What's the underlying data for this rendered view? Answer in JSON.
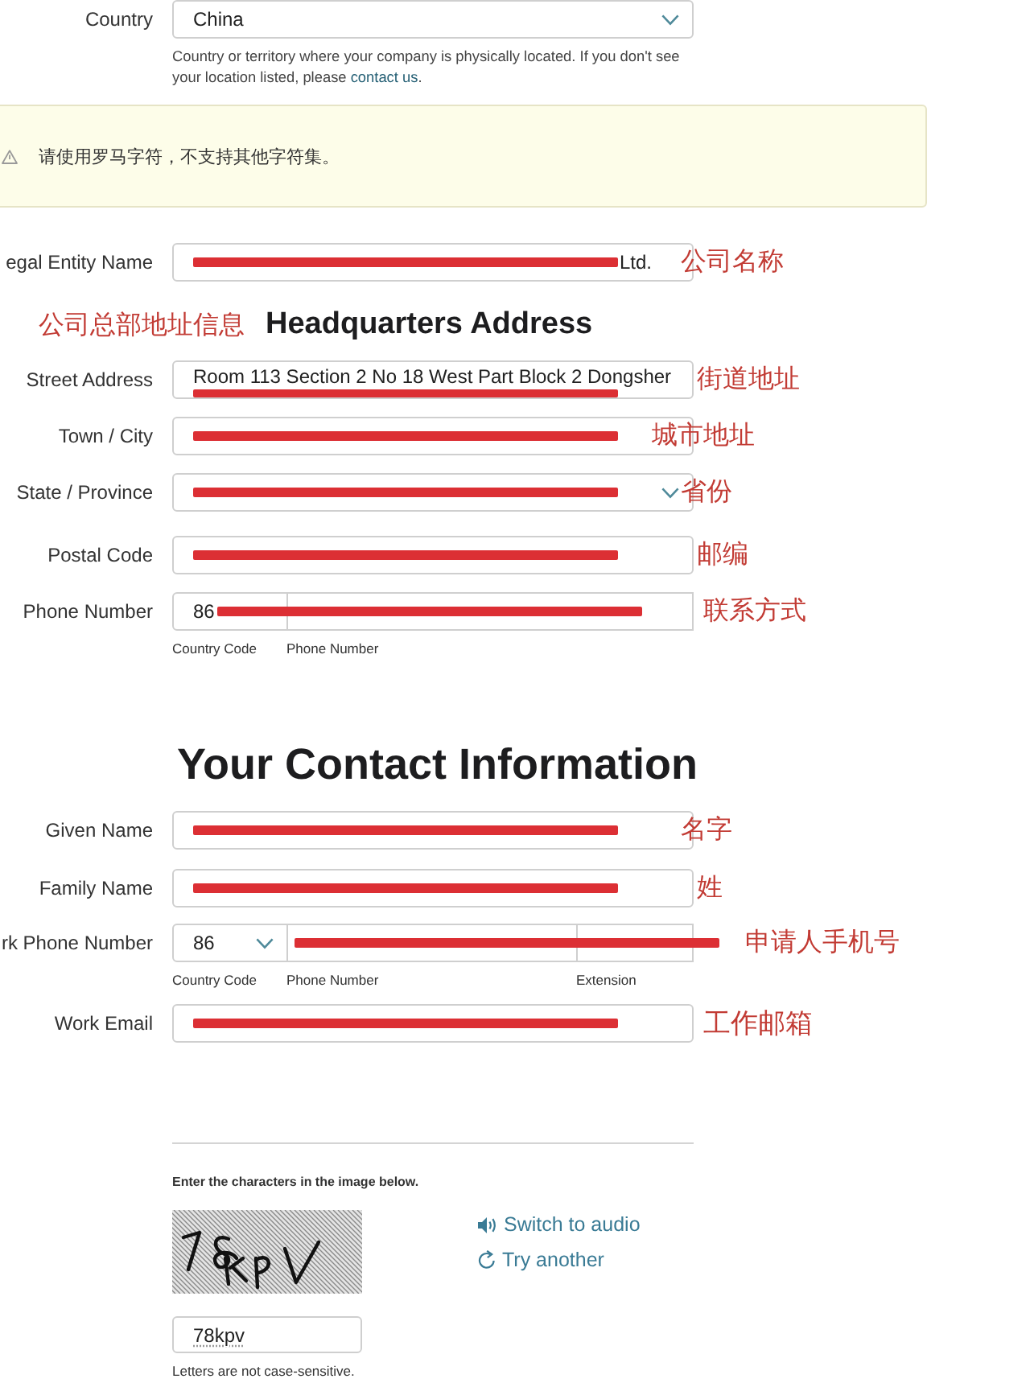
{
  "country": {
    "kind": "select",
    "label": "Country",
    "value": "China",
    "help": "Country or territory where your company is physically located. If you don't see your location listed, please ",
    "help_link": "contact us",
    "help_end": "."
  },
  "warning": {
    "text": "请使用罗马字符，不支持其他字符集。"
  },
  "entity": {
    "kind": "text",
    "label": "egal Entity Name",
    "value": "Ltd.",
    "redaction": {
      "kind": "hide"
    },
    "note": "公司名称"
  },
  "headquarters": {
    "note": "公司总部地址信息",
    "title": "Headquarters Address",
    "fields": [
      {
        "kind": "text",
        "label": "Street Address",
        "value": "Room 113 Section 2 No 18 West Part Block 2 Dongsher",
        "redaction": {
          "kind": "under"
        },
        "note": "街道地址"
      },
      {
        "kind": "text",
        "label": "Town / City",
        "redaction": {
          "kind": "hide"
        },
        "note": "城市地址"
      },
      {
        "kind": "select",
        "label": "State / Province",
        "redaction": {
          "kind": "hide"
        },
        "note": "省份"
      },
      {
        "kind": "text",
        "label": "Postal Code",
        "redaction": {
          "kind": "hide"
        },
        "note": "邮编"
      },
      {
        "kind": "phone",
        "label": "Phone Number",
        "code": {
          "value": "86",
          "label": "Country Code",
          "dropdown": false
        },
        "number": {
          "label": "Phone Number"
        },
        "redaction": {
          "kind": "across"
        },
        "note": "联系方式"
      }
    ]
  },
  "contact": {
    "title": "Your Contact Information",
    "fields": [
      {
        "kind": "text",
        "label": "Given Name",
        "redaction": {
          "kind": "hide"
        },
        "note": "名字"
      },
      {
        "kind": "text",
        "label": "Family Name",
        "redaction": {
          "kind": "hide"
        },
        "note": "姓"
      },
      {
        "kind": "phone",
        "label": "rk Phone Number",
        "code": {
          "value": "86",
          "label": "Country Code",
          "dropdown": true
        },
        "number": {
          "label": "Phone Number"
        },
        "extension": {
          "label": "Extension"
        },
        "redaction": {
          "kind": "hide"
        },
        "note": "申请人手机号"
      },
      {
        "kind": "text",
        "label": "Work Email",
        "redaction": {
          "kind": "hide"
        },
        "note": "工作邮箱"
      }
    ]
  },
  "captcha": {
    "instruction": "Enter the characters in the image below.",
    "actions": [
      {
        "kind": "audio",
        "label": "Switch to audio"
      },
      {
        "kind": "refresh",
        "label": "Try another"
      }
    ],
    "answer": "78kpv",
    "hint": "Letters are not case-sensitive."
  }
}
